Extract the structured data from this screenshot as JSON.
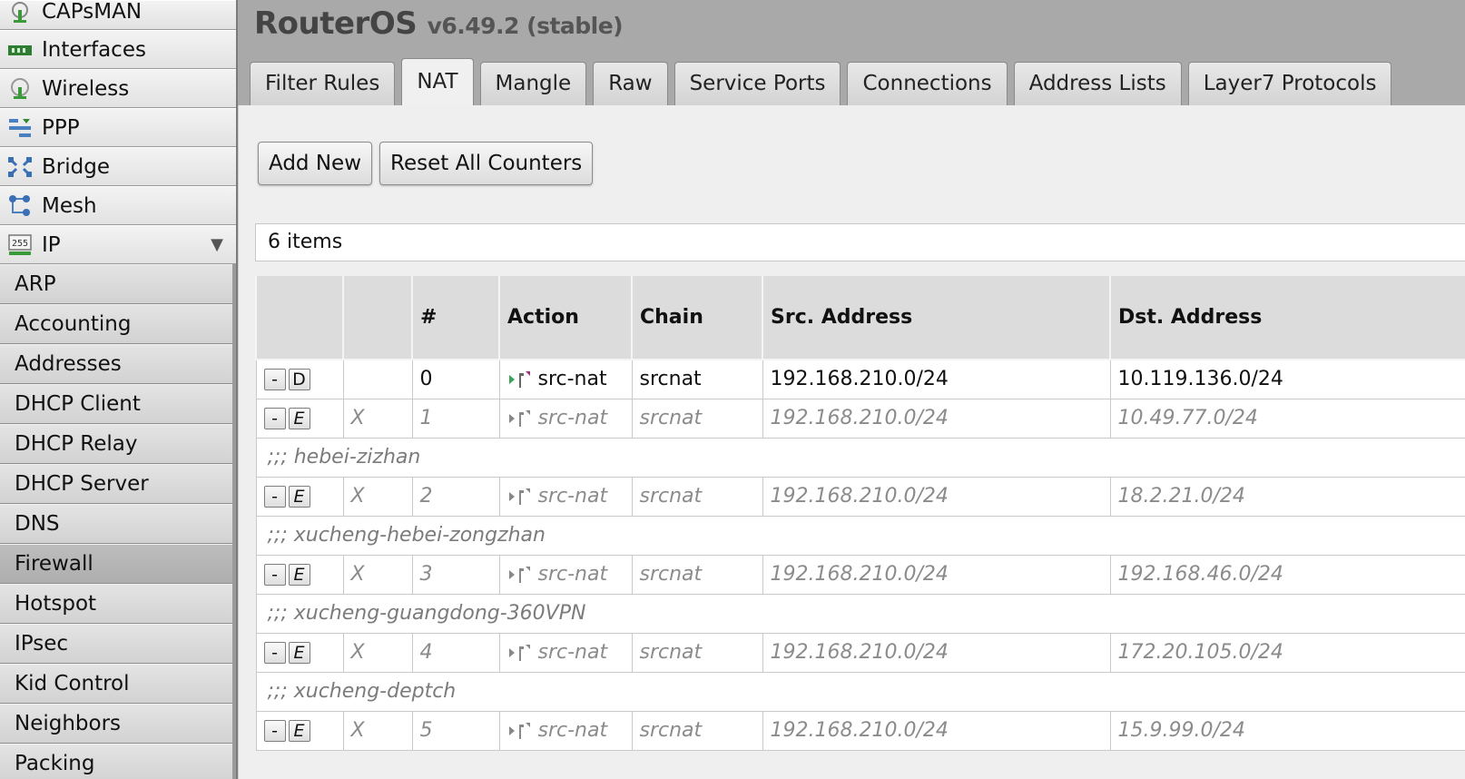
{
  "sidebar": {
    "top_items": [
      {
        "label": "CAPsMAN",
        "icon": "capsman-icon"
      },
      {
        "label": "Interfaces",
        "icon": "interfaces-icon"
      },
      {
        "label": "Wireless",
        "icon": "wireless-icon"
      },
      {
        "label": "PPP",
        "icon": "ppp-icon"
      },
      {
        "label": "Bridge",
        "icon": "bridge-icon"
      },
      {
        "label": "Mesh",
        "icon": "mesh-icon"
      },
      {
        "label": "IP",
        "icon": "ip-icon",
        "expanded": true
      }
    ],
    "ip_submenu": [
      {
        "label": "ARP"
      },
      {
        "label": "Accounting"
      },
      {
        "label": "Addresses"
      },
      {
        "label": "DHCP Client"
      },
      {
        "label": "DHCP Relay"
      },
      {
        "label": "DHCP Server"
      },
      {
        "label": "DNS"
      },
      {
        "label": "Firewall",
        "active": true
      },
      {
        "label": "Hotspot"
      },
      {
        "label": "IPsec"
      },
      {
        "label": "Kid Control"
      },
      {
        "label": "Neighbors"
      },
      {
        "label": "Packing"
      }
    ]
  },
  "header": {
    "product": "RouterOS",
    "version": "v6.49.2 (stable)"
  },
  "tabs": [
    {
      "label": "Filter Rules"
    },
    {
      "label": "NAT",
      "active": true
    },
    {
      "label": "Mangle"
    },
    {
      "label": "Raw"
    },
    {
      "label": "Service Ports"
    },
    {
      "label": "Connections"
    },
    {
      "label": "Address Lists"
    },
    {
      "label": "Layer7 Protocols"
    }
  ],
  "toolbar": {
    "add_new": "Add New",
    "reset_counters": "Reset All Counters"
  },
  "item_count": "6 items",
  "table": {
    "headers": [
      "",
      "",
      "#",
      "Action",
      "Chain",
      "Src. Address",
      "Dst. Address"
    ],
    "rows": [
      {
        "type": "rule",
        "remove": "-",
        "toggle": "D",
        "flag": "",
        "num": "0",
        "action": "src-nat",
        "chain": "srcnat",
        "src": "192.168.210.0/24",
        "dst": "10.119.136.0/24",
        "disabled": false
      },
      {
        "type": "rule",
        "remove": "-",
        "toggle": "E",
        "flag": "X",
        "num": "1",
        "action": "src-nat",
        "chain": "srcnat",
        "src": "192.168.210.0/24",
        "dst": "10.49.77.0/24",
        "disabled": true
      },
      {
        "type": "comment",
        "text": ";;; hebei-zizhan"
      },
      {
        "type": "rule",
        "remove": "-",
        "toggle": "E",
        "flag": "X",
        "num": "2",
        "action": "src-nat",
        "chain": "srcnat",
        "src": "192.168.210.0/24",
        "dst": "18.2.21.0/24",
        "disabled": true
      },
      {
        "type": "comment",
        "text": ";;; xucheng-hebei-zongzhan"
      },
      {
        "type": "rule",
        "remove": "-",
        "toggle": "E",
        "flag": "X",
        "num": "3",
        "action": "src-nat",
        "chain": "srcnat",
        "src": "192.168.210.0/24",
        "dst": "192.168.46.0/24",
        "disabled": true
      },
      {
        "type": "comment",
        "text": ";;; xucheng-guangdong-360VPN"
      },
      {
        "type": "rule",
        "remove": "-",
        "toggle": "E",
        "flag": "X",
        "num": "4",
        "action": "src-nat",
        "chain": "srcnat",
        "src": "192.168.210.0/24",
        "dst": "172.20.105.0/24",
        "disabled": true
      },
      {
        "type": "comment",
        "text": ";;; xucheng-deptch"
      },
      {
        "type": "rule",
        "remove": "-",
        "toggle": "E",
        "flag": "X",
        "num": "5",
        "action": "src-nat",
        "chain": "srcnat",
        "src": "192.168.210.0/24",
        "dst": "15.9.99.0/24",
        "disabled": true
      }
    ]
  },
  "colors": {
    "header_bg": "#a9a9a9",
    "content_bg": "#efefef",
    "active_menu": "#aeaeae",
    "action_icon_enabled": "#3aa35a",
    "action_icon_accent": "#a3307a"
  }
}
